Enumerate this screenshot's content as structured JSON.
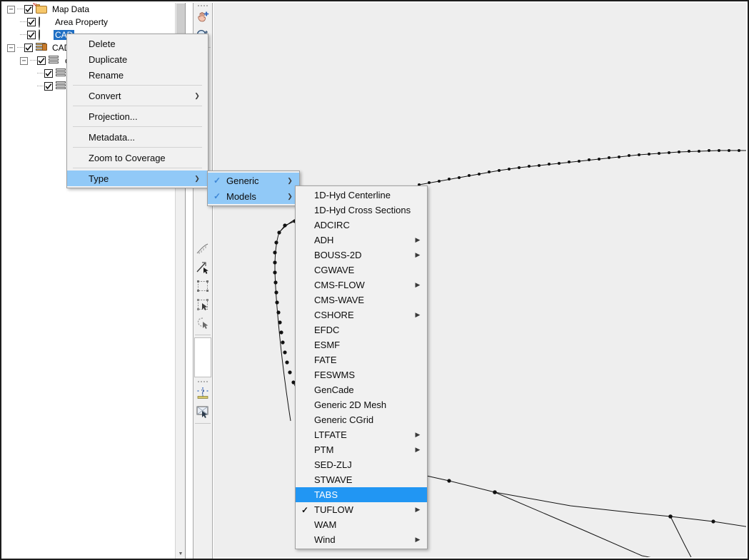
{
  "tree": {
    "items": [
      {
        "label": "Map Data",
        "icon": "folder-map-icon",
        "depth": 0,
        "checked": true,
        "expander": "minus"
      },
      {
        "label": "Area Property",
        "icon": "coverage-grey-icon",
        "depth": 1,
        "checked": true,
        "expander": "none"
      },
      {
        "label": "CAD",
        "icon": "coverage-green-icon",
        "depth": 1,
        "checked": true,
        "expander": "none",
        "selected": true
      },
      {
        "label": "CAD D",
        "icon": "cad-folder-icon",
        "depth": 0,
        "checked": true,
        "expander": "minus"
      },
      {
        "label": "ca",
        "icon": "cad-layer-icon",
        "depth": 1,
        "checked": true,
        "expander": "minus"
      },
      {
        "label": "",
        "icon": "cad-layer-icon",
        "depth": 2,
        "checked": true,
        "expander": "none"
      },
      {
        "label": "",
        "icon": "cad-layer-icon",
        "depth": 2,
        "checked": true,
        "expander": "none"
      }
    ]
  },
  "toolbar": {
    "buttons": [
      {
        "name": "pan-tool",
        "icon": "hand-pan-icon"
      },
      {
        "name": "zoom-tool",
        "icon": "magnifier-zoom-icon"
      },
      {
        "name": "create-feature-arc-tool",
        "icon": "arc-draw-icon"
      },
      {
        "name": "select-feature-point-tool",
        "icon": "select-point-icon"
      },
      {
        "name": "select-feature-arc-tool",
        "icon": "select-arc-arrow-icon"
      },
      {
        "name": "select-feature-polygon-tool",
        "icon": "select-polygon-icon"
      },
      {
        "name": "select-with-box-tool",
        "icon": "box-select-icon"
      },
      {
        "name": "select-with-lasso-tool",
        "icon": "lasso-select-icon"
      },
      {
        "name": "help-context-tool",
        "icon": "help-question-icon"
      },
      {
        "name": "screenshot-tool",
        "icon": "screen-capture-icon"
      }
    ]
  },
  "context_menu": {
    "items": [
      {
        "label": "Delete",
        "submenu": false,
        "separator_after": false
      },
      {
        "label": "Duplicate",
        "submenu": false,
        "separator_after": false
      },
      {
        "label": "Rename",
        "submenu": false,
        "separator_after": true
      },
      {
        "label": "Convert",
        "submenu": true,
        "separator_after": true
      },
      {
        "label": "Projection...",
        "submenu": false,
        "separator_after": true
      },
      {
        "label": "Metadata...",
        "submenu": false,
        "separator_after": true
      },
      {
        "label": "Zoom to Coverage",
        "submenu": false,
        "separator_after": true
      },
      {
        "label": "Type",
        "submenu": true,
        "highlighted": true,
        "separator_after": false
      }
    ]
  },
  "type_menu": {
    "items": [
      {
        "label": "Generic",
        "checked": true,
        "submenu": true,
        "highlight": "light"
      },
      {
        "label": "Models",
        "checked": true,
        "submenu": true,
        "highlight": "strong-light"
      }
    ]
  },
  "models_menu": {
    "items": [
      {
        "label": "1D-Hyd Centerline",
        "submenu": false,
        "checked": false
      },
      {
        "label": "1D-Hyd Cross Sections",
        "submenu": false,
        "checked": false
      },
      {
        "label": "ADCIRC",
        "submenu": false,
        "checked": false
      },
      {
        "label": "ADH",
        "submenu": true,
        "checked": false
      },
      {
        "label": "BOUSS-2D",
        "submenu": true,
        "checked": false
      },
      {
        "label": "CGWAVE",
        "submenu": false,
        "checked": false
      },
      {
        "label": "CMS-FLOW",
        "submenu": true,
        "checked": false
      },
      {
        "label": "CMS-WAVE",
        "submenu": false,
        "checked": false
      },
      {
        "label": "CSHORE",
        "submenu": true,
        "checked": false
      },
      {
        "label": "EFDC",
        "submenu": false,
        "checked": false
      },
      {
        "label": "ESMF",
        "submenu": false,
        "checked": false
      },
      {
        "label": "FATE",
        "submenu": false,
        "checked": false
      },
      {
        "label": "FESWMS",
        "submenu": false,
        "checked": false
      },
      {
        "label": "GenCade",
        "submenu": false,
        "checked": false
      },
      {
        "label": "Generic 2D Mesh",
        "submenu": false,
        "checked": false
      },
      {
        "label": "Generic CGrid",
        "submenu": false,
        "checked": false
      },
      {
        "label": "LTFATE",
        "submenu": true,
        "checked": false
      },
      {
        "label": "PTM",
        "submenu": true,
        "checked": false
      },
      {
        "label": "SED-ZLJ",
        "submenu": false,
        "checked": false
      },
      {
        "label": "STWAVE",
        "submenu": false,
        "checked": false
      },
      {
        "label": "TABS",
        "submenu": false,
        "checked": false,
        "selected": true
      },
      {
        "label": "TUFLOW",
        "submenu": true,
        "checked": true
      },
      {
        "label": "WAM",
        "submenu": false,
        "checked": false
      },
      {
        "label": "Wind",
        "submenu": true,
        "checked": false
      }
    ]
  },
  "colors": {
    "menu_background": "#f1f1f1",
    "highlight_light": "#91c9f7",
    "highlight_strong": "#2196f3",
    "tree_selection": "#1f6fc4",
    "canvas_background": "#eeeeee",
    "feature_line": "#111111"
  },
  "glyphs": {
    "arrow_right": "▶",
    "check": "✓",
    "minus": "−",
    "plus": "+"
  }
}
